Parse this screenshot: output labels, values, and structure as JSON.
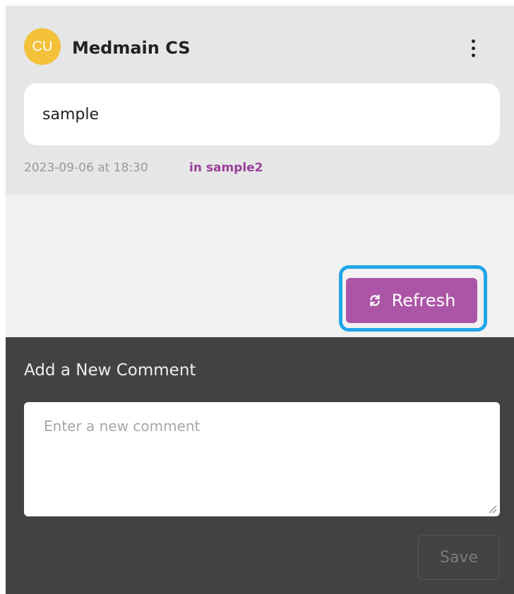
{
  "comment": {
    "avatar_initials": "CU",
    "author": "Medmain CS",
    "body": "sample",
    "timestamp": "2023-09-06 at 18:30",
    "location": "in sample2",
    "menu_icon": "more-vertical-icon",
    "avatar_color": "#f4c13a",
    "location_color": "#9b3f9c"
  },
  "refresh": {
    "label": "Refresh",
    "icon": "refresh-icon",
    "color": "#ac55a7",
    "highlight_color": "#1fa6e8"
  },
  "new_comment": {
    "heading": "Add a New Comment",
    "placeholder": "Enter a new comment",
    "value": "",
    "save_label": "Save",
    "background": "#424242"
  }
}
